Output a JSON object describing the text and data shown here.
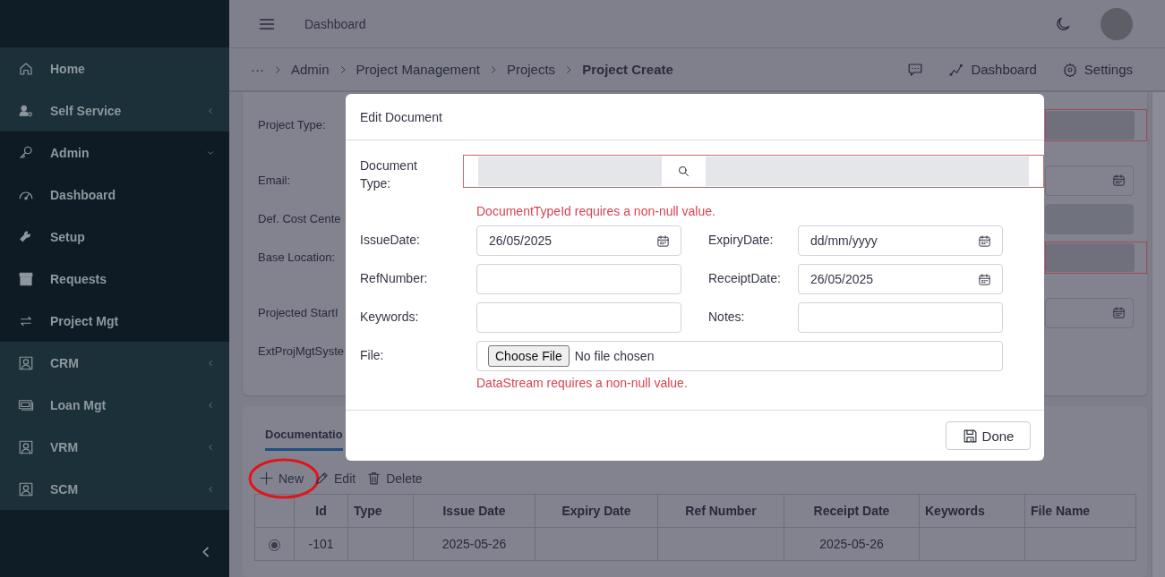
{
  "header": {
    "title": "Dashboard"
  },
  "breadcrumb": {
    "items": [
      {
        "label": "···",
        "current": false
      },
      {
        "label": "Admin",
        "current": false
      },
      {
        "label": "Project Management",
        "current": false
      },
      {
        "label": "Projects",
        "current": false
      },
      {
        "label": "Project Create",
        "current": true
      }
    ],
    "links": [
      {
        "label": "Dashboard"
      },
      {
        "label": "Settings"
      }
    ]
  },
  "sidebar": {
    "items": [
      {
        "label": "Home",
        "kind": "link",
        "tinted": true
      },
      {
        "label": "Self Service",
        "kind": "submenu",
        "expanded": false,
        "tinted": true
      },
      {
        "label": "Admin",
        "kind": "submenu",
        "expanded": true,
        "tinted": false
      },
      {
        "label": "Dashboard",
        "kind": "link",
        "tinted": false
      },
      {
        "label": "Setup",
        "kind": "link",
        "tinted": false
      },
      {
        "label": "Requests",
        "kind": "link",
        "tinted": false
      },
      {
        "label": "Project Mgt",
        "kind": "link",
        "tinted": false
      },
      {
        "label": "CRM",
        "kind": "submenu",
        "expanded": false,
        "tinted": true
      },
      {
        "label": "Loan Mgt",
        "kind": "submenu",
        "expanded": false,
        "tinted": true
      },
      {
        "label": "VRM",
        "kind": "submenu",
        "expanded": false,
        "tinted": true
      },
      {
        "label": "SCM",
        "kind": "submenu",
        "expanded": false,
        "tinted": true
      }
    ]
  },
  "form": {
    "fields": [
      {
        "label": "Project Type:",
        "kind": "select",
        "invalid": true
      },
      {
        "label": "Email:",
        "kind": "date",
        "invalid": false
      },
      {
        "label": "Def. Cost Cente",
        "kind": "readonly",
        "invalid": false
      },
      {
        "label": "Base Location:",
        "kind": "select",
        "invalid": true
      },
      {
        "label": "Projected StartI",
        "kind": "date",
        "invalid": false
      },
      {
        "label": "ExtProjMgtSyste",
        "kind": "none"
      }
    ]
  },
  "documents": {
    "tabs": [
      {
        "label": "Documentatio",
        "selected": true
      }
    ],
    "actions": [
      {
        "label": "New",
        "circled": true
      },
      {
        "label": "Edit",
        "circled": false
      },
      {
        "label": "Delete",
        "circled": false
      }
    ],
    "table": {
      "columns": [
        "Id",
        "Type",
        "Issue Date",
        "Expiry Date",
        "Ref Number",
        "Receipt Date",
        "Keywords",
        "File Name"
      ],
      "rows": [
        {
          "selected": true,
          "cells": [
            "-101",
            "",
            "2025-05-26",
            "",
            "",
            "2025-05-26",
            "",
            ""
          ]
        }
      ]
    }
  },
  "dialog": {
    "title": "Edit Document",
    "document_type": {
      "label": "Document Type:",
      "invalid": true,
      "error": "DocumentTypeId requires a non-null value."
    },
    "fields": [
      {
        "label": "IssueDate:",
        "kind": "date",
        "value": "26/05/2025"
      },
      {
        "label": "ExpiryDate:",
        "kind": "date",
        "placeholder": "dd/mm/yyyy"
      },
      {
        "label": "RefNumber:",
        "kind": "text"
      },
      {
        "label": "ReceiptDate:",
        "kind": "date",
        "value": "26/05/2025"
      },
      {
        "label": "Keywords:",
        "kind": "text"
      },
      {
        "label": "Notes:",
        "kind": "text"
      }
    ],
    "file": {
      "label": "File:",
      "button": "Choose File",
      "status": "No file chosen",
      "error": "DataStream requires a non-null value."
    },
    "done": "Done"
  }
}
